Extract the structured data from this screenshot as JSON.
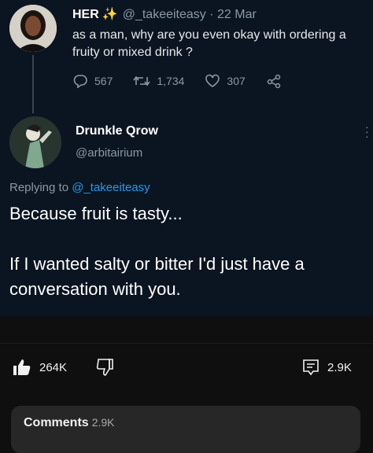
{
  "original_tweet": {
    "display_name": "HER",
    "sparkle_icon": "sparkle-icon",
    "handle": "@_takeeiteasy",
    "date": "22 Mar",
    "text": "as a man, why are you even okay with ordering a fruity or mixed drink ?",
    "replies": "567",
    "retweets": "1,734",
    "likes": "307"
  },
  "reply_tweet": {
    "display_name": "Drunkle Qrow",
    "handle": "@arbitairium",
    "replying_to_prefix": "Replying to",
    "replying_to_handle": "@_takeeiteasy",
    "line1": "Because fruit is tasty...",
    "line2": "If I wanted salty or bitter I'd just have a conversation with you."
  },
  "video_actions": {
    "like_count": "264K",
    "comment_count": "2.9K"
  },
  "comments_section": {
    "label": "Comments",
    "count": "2.9K"
  },
  "colors": {
    "tweet_bg": "#0b1521",
    "page_bg": "#0f0f0f",
    "link_blue": "#1d9bf0",
    "muted": "#8b98a5"
  }
}
